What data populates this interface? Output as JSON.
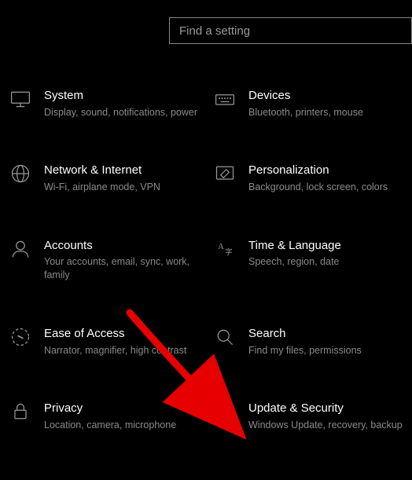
{
  "search": {
    "placeholder": "Find a setting"
  },
  "tiles": [
    {
      "title": "System",
      "desc": "Display, sound, notifications, power"
    },
    {
      "title": "Devices",
      "desc": "Bluetooth, printers, mouse"
    },
    {
      "title": "Network & Internet",
      "desc": "Wi-Fi, airplane mode, VPN"
    },
    {
      "title": "Personalization",
      "desc": "Background, lock screen, colors"
    },
    {
      "title": "Accounts",
      "desc": "Your accounts, email, sync, work, family"
    },
    {
      "title": "Time & Language",
      "desc": "Speech, region, date"
    },
    {
      "title": "Ease of Access",
      "desc": "Narrator, magnifier, high contrast"
    },
    {
      "title": "Search",
      "desc": "Find my files, permissions"
    },
    {
      "title": "Privacy",
      "desc": "Location, camera, microphone"
    },
    {
      "title": "Update & Security",
      "desc": "Windows Update, recovery, backup"
    }
  ],
  "annotation": {
    "arrow_color": "#e60000"
  }
}
